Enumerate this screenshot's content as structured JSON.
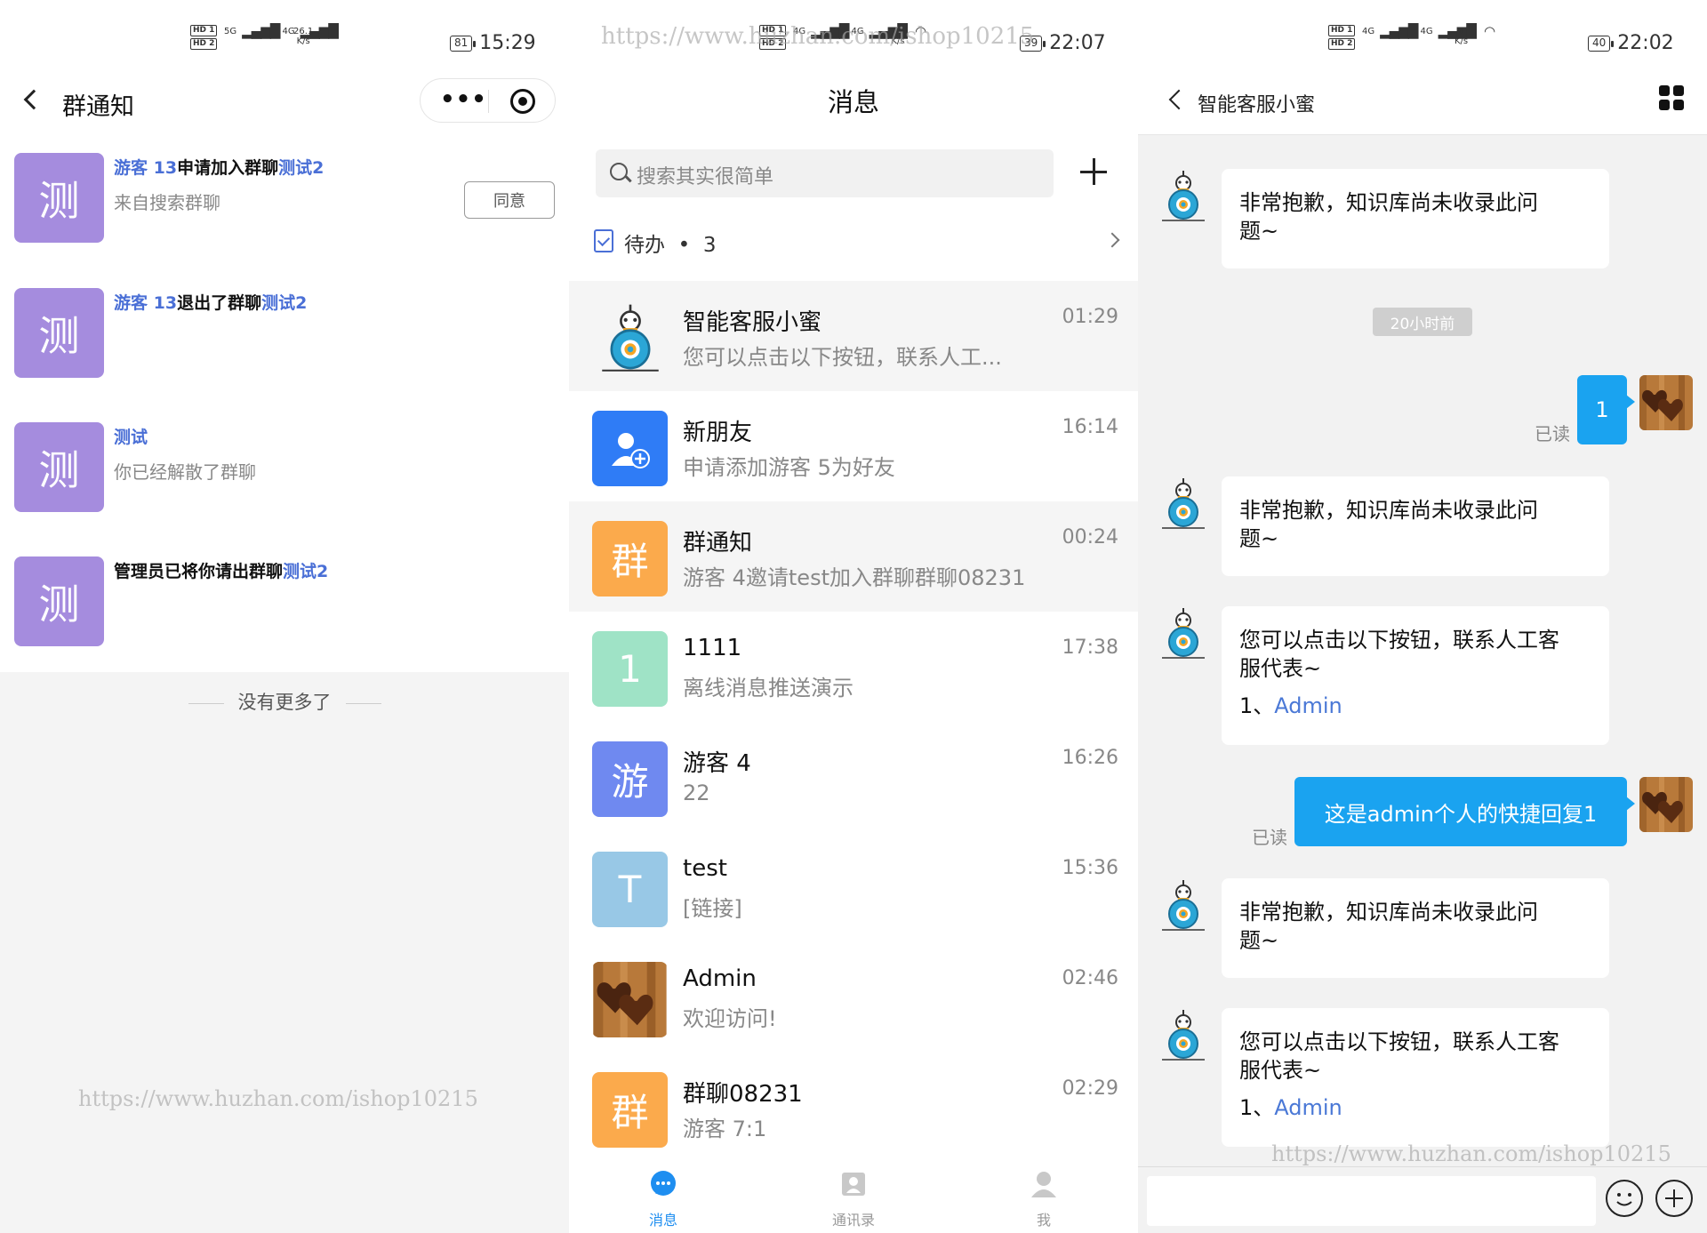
{
  "panel_notice": {
    "status": {
      "net1": "5G",
      "net2": "4G",
      "speed": "26.1",
      "speed_unit": "K/s",
      "battery": "81",
      "time": "15:29"
    },
    "title": "群通知",
    "capsule": {
      "dots": "•••"
    },
    "items": [
      {
        "avatar_text": "测",
        "parts": [
          {
            "t": "游客 13",
            "c": "blue"
          },
          {
            "t": "申请加入群聊",
            "c": "dark"
          },
          {
            "t": "测试2",
            "c": "blue"
          }
        ],
        "sub": "来自搜索群聊"
      },
      {
        "avatar_text": "测",
        "parts": [
          {
            "t": "游客 13",
            "c": "blue"
          },
          {
            "t": "退出了群聊",
            "c": "dark"
          },
          {
            "t": "测试2",
            "c": "blue"
          }
        ],
        "sub": ""
      },
      {
        "avatar_text": "测",
        "parts": [
          {
            "t": "测试",
            "c": "blue"
          }
        ],
        "sub": "你已经解散了群聊"
      },
      {
        "avatar_text": "测",
        "parts": [
          {
            "t": "管理员已将你请出群聊",
            "c": "dark"
          },
          {
            "t": "测试2",
            "c": "blue"
          }
        ],
        "sub": ""
      }
    ],
    "agree_label": "同意",
    "no_more": "没有更多了",
    "watermark": "https://www.huzhan.com/ishop10215"
  },
  "panel_messages": {
    "status": {
      "net1": "4G",
      "net2": "4G",
      "speed": "1.5",
      "speed_unit": "K/s",
      "battery": "39",
      "time": "22:07"
    },
    "watermark_top": "https://www.huzhan.com/ishop10215",
    "title": "消息",
    "search_placeholder": "搜索其实很简单",
    "todo_label": "待办",
    "todo_dot": "•",
    "todo_count": "3",
    "conversations": [
      {
        "name": "智能客服小蜜",
        "msg": "您可以点击以下按钮，联系人工...",
        "time": "01:29",
        "avatar": "bot",
        "color": "#ffffff",
        "highlight": true
      },
      {
        "name": "新朋友",
        "msg": "申请添加游客 5为好友",
        "time": "16:14",
        "avatar": "add-friend",
        "color": "#2f7cf6",
        "highlight": false
      },
      {
        "name": "群通知",
        "msg": "游客 4邀请test加入群聊群聊08231",
        "time": "00:24",
        "avatar": "text",
        "avatar_text": "群",
        "color": "#fbaa4c",
        "highlight": true
      },
      {
        "name": "1111",
        "msg": "离线消息推送演示",
        "time": "17:38",
        "avatar": "text",
        "avatar_text": "1",
        "color": "#9fe3c6",
        "highlight": false
      },
      {
        "name": "游客 4",
        "msg": "22",
        "time": "16:26",
        "avatar": "text",
        "avatar_text": "游",
        "color": "#6f89f0",
        "highlight": false
      },
      {
        "name": "test",
        "msg": "[链接]",
        "time": "15:36",
        "avatar": "text",
        "avatar_text": "T",
        "color": "#98c8e6",
        "highlight": false
      },
      {
        "name": "Admin",
        "msg": "欢迎访问!",
        "time": "02:46",
        "avatar": "hearts",
        "color": "#8a5a2b",
        "highlight": false
      },
      {
        "name": "群聊08231",
        "msg": "游客 7:1",
        "time": "02:29",
        "avatar": "text",
        "avatar_text": "群",
        "color": "#fbaa4c",
        "highlight": false
      }
    ],
    "tabs": [
      {
        "label": "消息",
        "active": true
      },
      {
        "label": "通讯录",
        "active": false
      },
      {
        "label": "我",
        "active": false
      }
    ],
    "accent": "#1e8ef0"
  },
  "panel_chat": {
    "status": {
      "net1": "4G",
      "net2": "4G",
      "speed": "6",
      "speed_unit": "K/s",
      "battery": "40",
      "time": "22:02"
    },
    "title": "智能客服小蜜",
    "messages": [
      {
        "side": "left",
        "lines": [
          "非常抱歉，知识库尚未收录此问",
          "题~"
        ]
      },
      {
        "side": "time",
        "text": "20小时前"
      },
      {
        "side": "right",
        "text": "1",
        "read": "已读"
      },
      {
        "side": "left",
        "lines": [
          "非常抱歉，知识库尚未收录此问",
          "题~"
        ]
      },
      {
        "side": "left",
        "lines": [
          "您可以点击以下按钮，联系人工客",
          "服代表~"
        ],
        "link_prefix": "1、",
        "link": "Admin"
      },
      {
        "side": "right",
        "text": "这是admin个人的快捷回复1",
        "read": "已读"
      },
      {
        "side": "left",
        "lines": [
          "非常抱歉，知识库尚未收录此问",
          "题~"
        ]
      },
      {
        "side": "left",
        "lines": [
          "您可以点击以下按钮，联系人工客",
          "服代表~"
        ],
        "link_prefix": "1、",
        "link": "Admin"
      }
    ],
    "watermark": "https://www.huzhan.com/ishop10215",
    "bubble_color": "#1aa3f0"
  }
}
